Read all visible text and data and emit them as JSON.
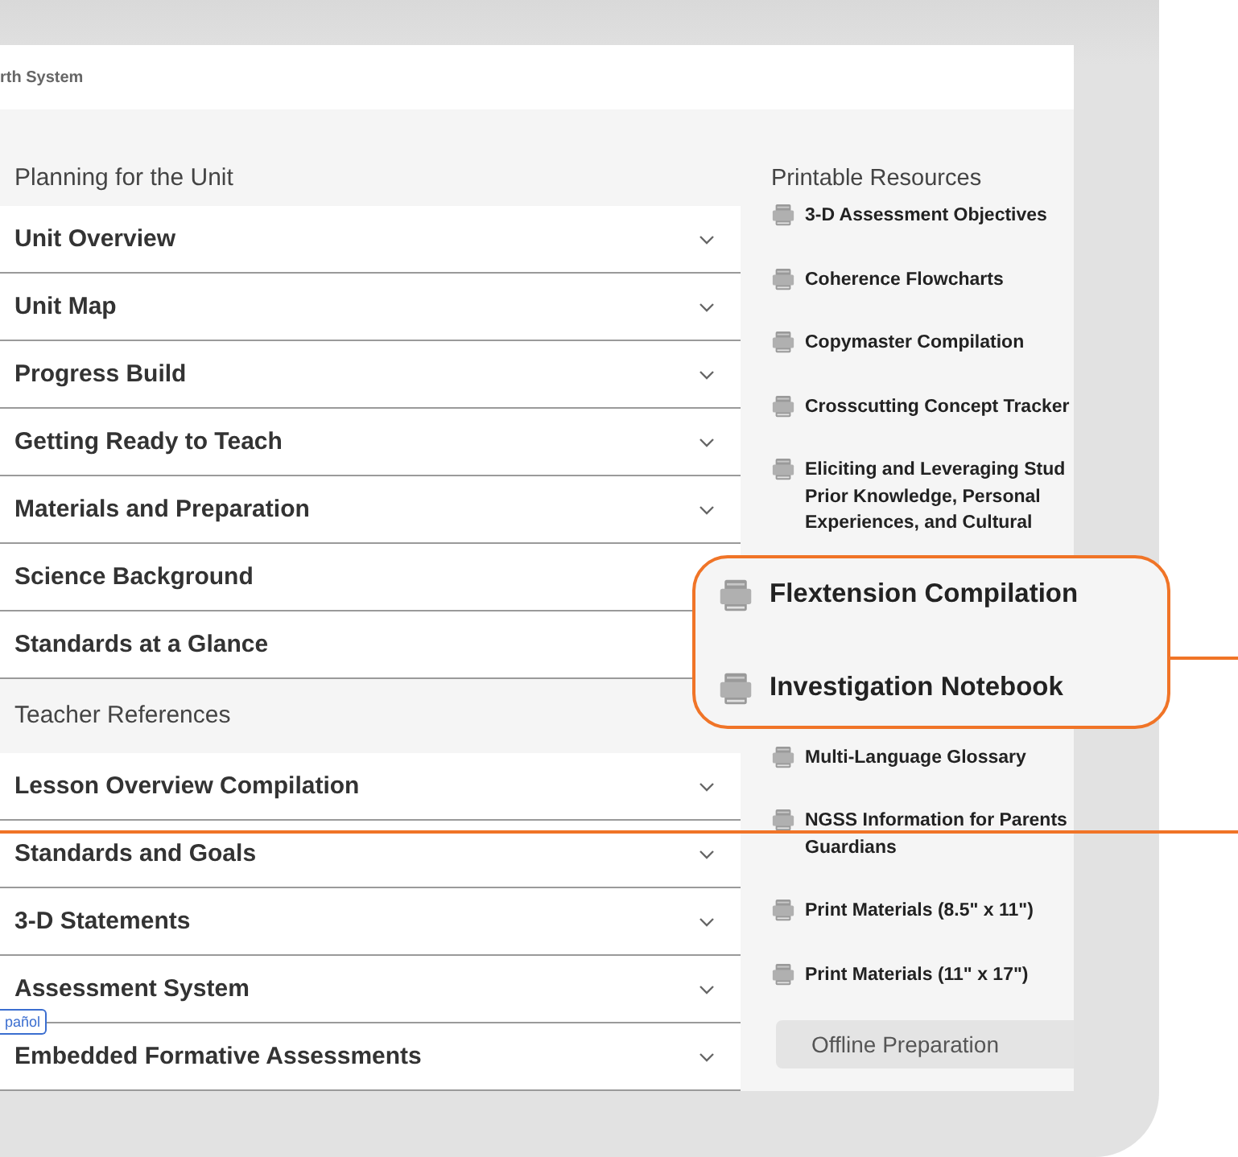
{
  "header": {
    "title": "rth System"
  },
  "planning": {
    "heading": "Planning for the Unit",
    "items": [
      {
        "label": "Unit Overview"
      },
      {
        "label": "Unit Map"
      },
      {
        "label": "Progress Build"
      },
      {
        "label": "Getting Ready to Teach"
      },
      {
        "label": "Materials and Preparation"
      },
      {
        "label": "Science Background"
      },
      {
        "label": "Standards at a Glance"
      }
    ]
  },
  "teacher_references": {
    "heading": "Teacher References",
    "items": [
      {
        "label": "Lesson Overview Compilation"
      },
      {
        "label": "Standards and Goals"
      },
      {
        "label": "3-D Statements"
      },
      {
        "label": "Assessment System"
      },
      {
        "label": "Embedded Formative Assessments"
      }
    ]
  },
  "language_toggle": {
    "label": "pañol"
  },
  "printable_resources": {
    "heading": "Printable Resources",
    "items": [
      {
        "label": "3-D Assessment Objectives",
        "kind": "pdf"
      },
      {
        "label": "Coherence Flowcharts",
        "kind": "pdf"
      },
      {
        "label": "Copymaster Compilation",
        "kind": "pdf"
      },
      {
        "label": "Crosscutting Concept Tracker",
        "kind": "pdf"
      },
      {
        "label": "Eliciting and Leveraging Stud Prior Knowledge, Personal Experiences, and Cultural",
        "kind": "pdf"
      },
      {
        "label": "Flextension Compilation",
        "kind": "callout"
      },
      {
        "label": "Investigation Notebook",
        "kind": "callout"
      },
      {
        "label": "Multi-Language Glossary",
        "kind": "pdf"
      },
      {
        "label": "NGSS Information for Parents Guardians",
        "kind": "pdf"
      },
      {
        "label": "Print Materials (8.5\" x 11\")",
        "kind": "pdf"
      },
      {
        "label": "Print Materials (11\" x 17\")",
        "kind": "pdf"
      }
    ]
  },
  "offline_button": {
    "label": "Offline Preparation"
  }
}
